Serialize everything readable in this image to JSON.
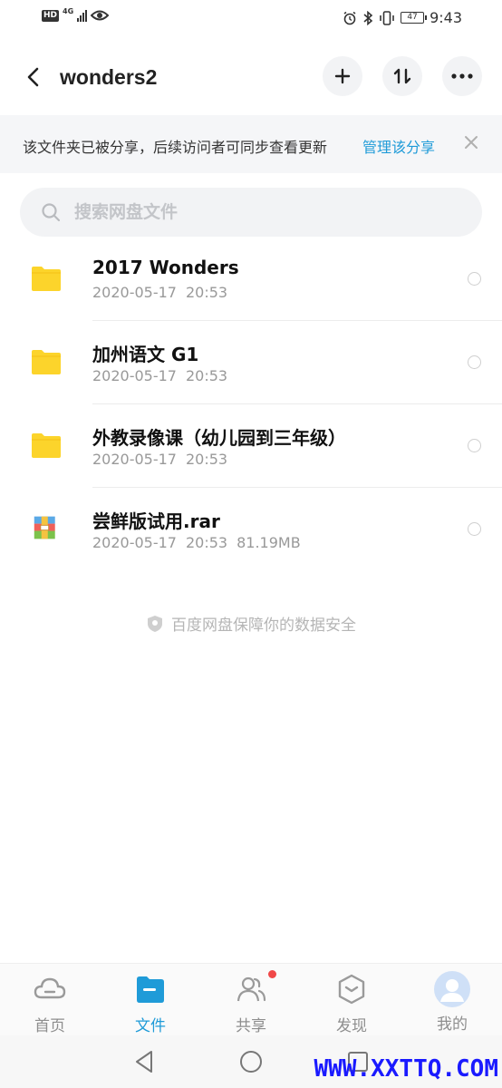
{
  "status_bar": {
    "hd": "HD",
    "network": "4G",
    "battery": "47",
    "time": "9:43"
  },
  "header": {
    "title": "wonders2"
  },
  "share_banner": {
    "text": "该文件夹已被分享，后续访问者可同步查看更新",
    "link": "管理该分享"
  },
  "search": {
    "placeholder": "搜索网盘文件"
  },
  "files": [
    {
      "name": "2017 Wonders",
      "date": "2020-05-17",
      "time": "20:53",
      "size": "",
      "type": "folder"
    },
    {
      "name": "加州语文 G1",
      "date": "2020-05-17",
      "time": "20:53",
      "size": "",
      "type": "folder"
    },
    {
      "name": "外教录像课（幼儿园到三年级）",
      "date": "2020-05-17",
      "time": "20:53",
      "size": "",
      "type": "folder"
    },
    {
      "name": "尝鲜版试用.rar",
      "date": "2020-05-17",
      "time": "20:53",
      "size": "81.19MB",
      "type": "archive"
    }
  ],
  "secure_note": "百度网盘保障你的数据安全",
  "bottom_nav": {
    "home": "首页",
    "files": "文件",
    "share": "共享",
    "discover": "发现",
    "mine": "我的"
  },
  "colors": {
    "accent": "#1f9bd8",
    "folder": "#fcd42b",
    "badge": "#f04848"
  },
  "watermark": "WWW.XXTTQ.COM"
}
